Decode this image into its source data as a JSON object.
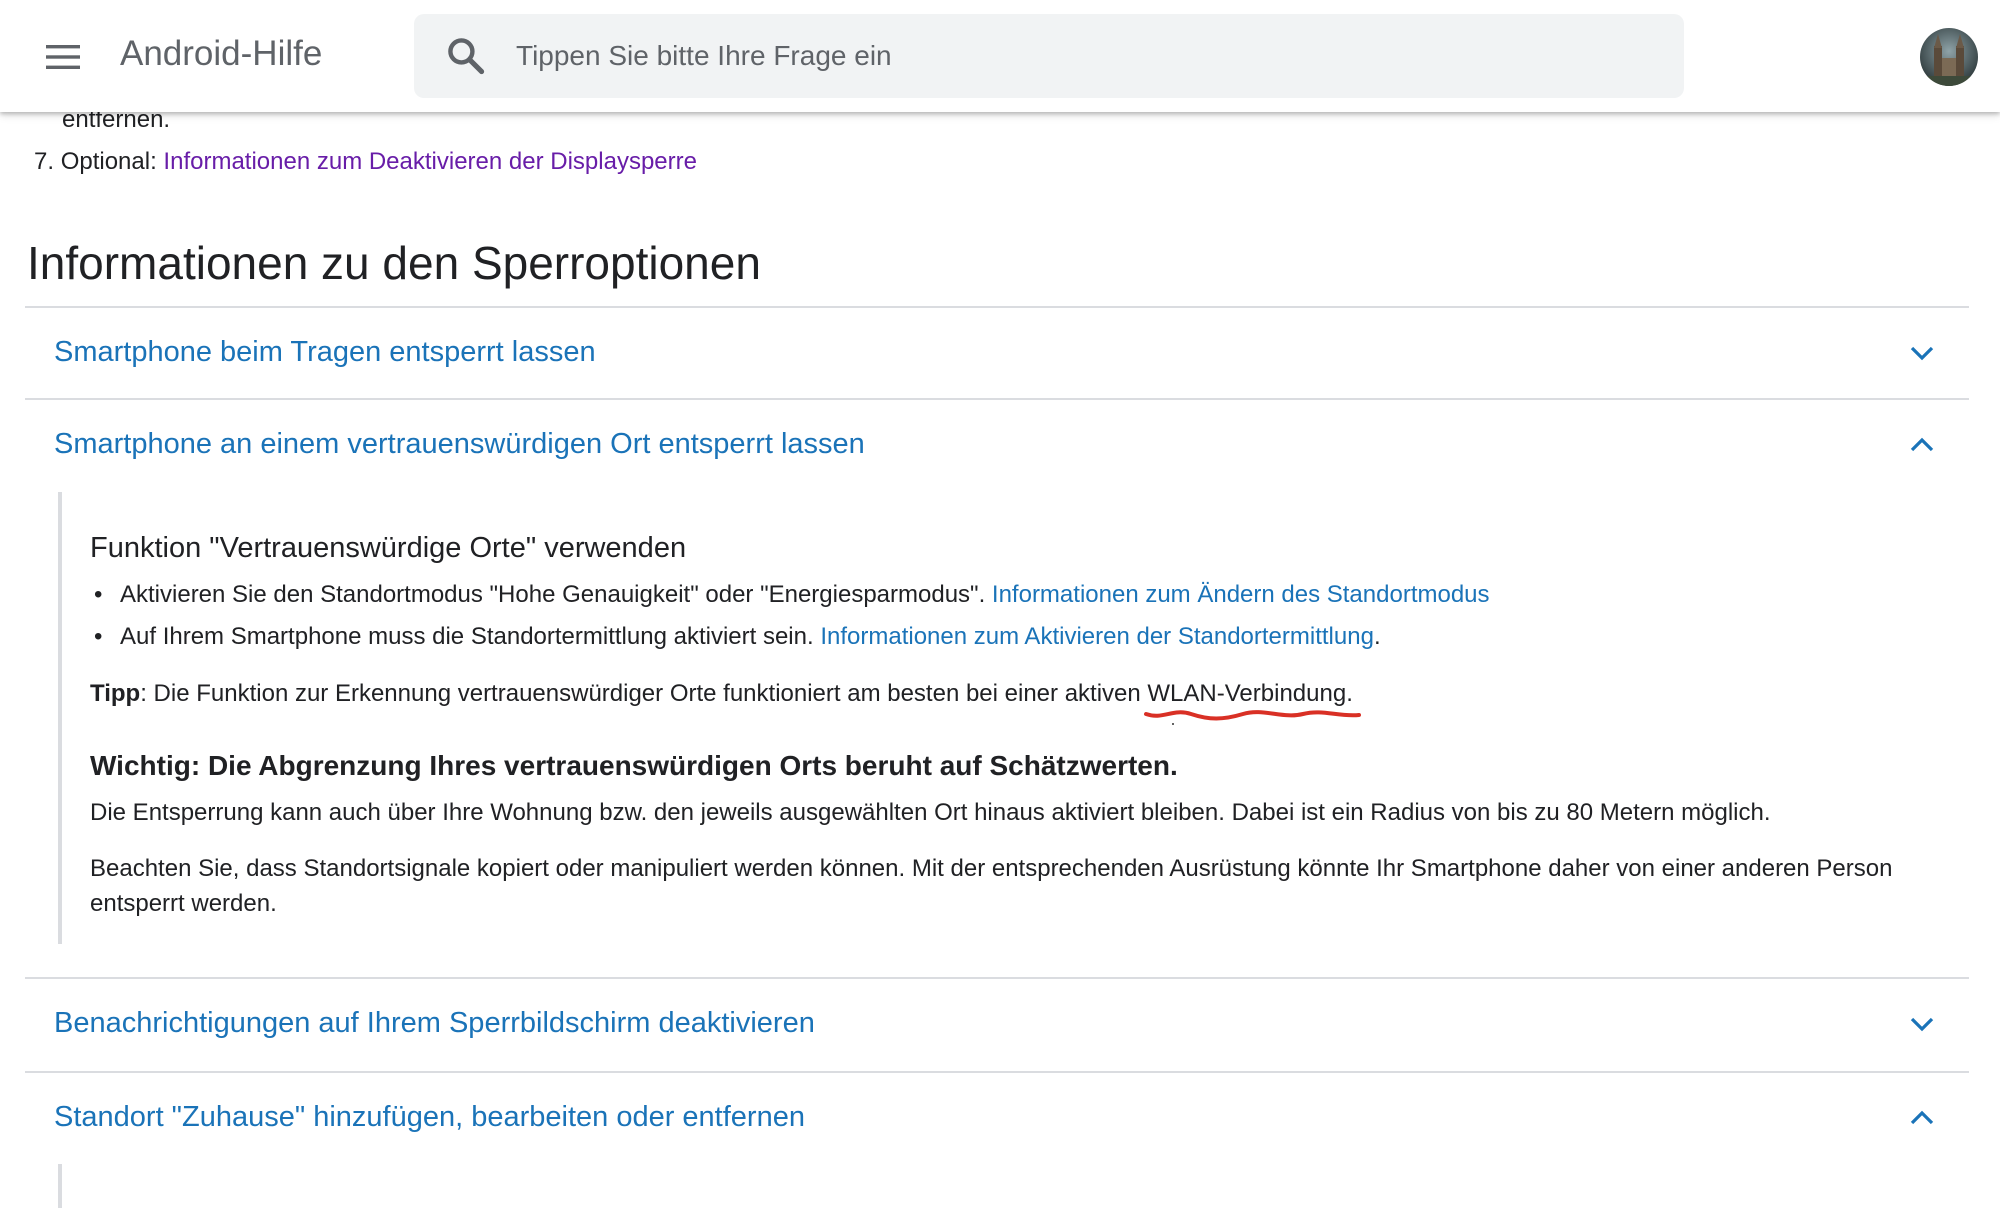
{
  "appbar": {
    "title": "Android-Hilfe",
    "search_placeholder": "Tippen Sie bitte Ihre Frage ein",
    "menu_icon": "hamburger-menu-icon",
    "search_icon": "search-icon",
    "avatar_icon": "account-avatar"
  },
  "steps": {
    "tail_text": "entfernen.",
    "item7_number": "7.",
    "item7_prefix": "Optional:",
    "item7_link": "Informationen zum Deaktivieren der Displaysperre"
  },
  "section": {
    "heading": "Informationen zu den Sperroptionen"
  },
  "accordion": [
    {
      "title": "Smartphone beim Tragen entsperrt lassen",
      "expanded": false
    },
    {
      "title": "Smartphone an einem vertrauenswürdigen Ort entsperrt lassen",
      "expanded": true
    },
    {
      "title": "Benachrichtigungen auf Ihrem Sperrbildschirm deaktivieren",
      "expanded": false
    },
    {
      "title": "Standort \"Zuhause\" hinzufügen, bearbeiten oder entfernen",
      "expanded": true
    }
  ],
  "trusted_places": {
    "heading": "Funktion \"Vertrauenswürdige Orte\" verwenden",
    "bullets": [
      {
        "text": "Aktivieren Sie den Standortmodus \"Hohe Genauigkeit\" oder \"Energiesparmodus\".",
        "link": "Informationen zum Ändern des Standortmodus",
        "suffix": ""
      },
      {
        "text": "Auf Ihrem Smartphone muss die Standortermittlung aktiviert sein.",
        "link": "Informationen zum Aktivieren der Standortermittlung",
        "suffix": "."
      }
    ],
    "tip_label": "Tipp",
    "tip_text": ": Die Funktion zur Erkennung vertrauenswürdiger Orte funktioniert am besten bei einer aktiven ",
    "tip_highlight": "WLAN-Verbindung",
    "tip_end": ".",
    "important_heading": "Wichtig: Die Abgrenzung Ihres vertrauenswürdigen Orts beruht auf Schätzwerten.",
    "para1": "Die Entsperrung kann auch über Ihre Wohnung bzw. den jeweils ausgewählten Ort hinaus aktiviert bleiben. Dabei ist ein Radius von bis zu 80 Metern möglich.",
    "para2": "Beachten Sie, dass Standortsignale kopiert oder manipuliert werden können. Mit der entsprechenden Ausrüstung könnte Ihr Smartphone daher von einer anderen Person entsperrt werden."
  },
  "colors": {
    "link_blue": "#1a73b8",
    "visited_link": "#681da8",
    "annotation_red": "#d93025",
    "divider": "#dadce0"
  }
}
